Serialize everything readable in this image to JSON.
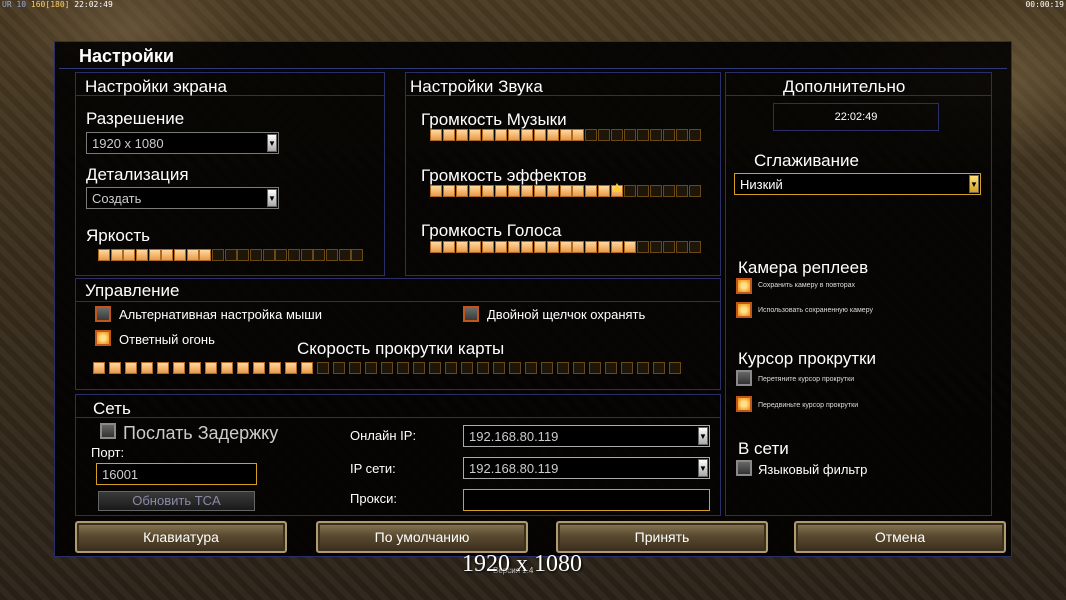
{
  "hud": {
    "left_a": "UR 10",
    "left_b": "160[180]",
    "left_time": "22:02:49",
    "right_time": "00:00:19"
  },
  "dialog": {
    "title": "Настройки"
  },
  "screen": {
    "title": "Настройки экрана",
    "resolution_label": "Разрешение",
    "resolution_value": "1920 x 1080",
    "detail_label": "Детализация",
    "detail_value": "Создать",
    "brightness_label": "Яркость",
    "brightness_level": 9,
    "brightness_total": 21
  },
  "sound": {
    "title": "Настройки Звука",
    "music_label": "Громкость Музыки",
    "music_level": 12,
    "effects_label": "Громкость эффектов",
    "effects_level": 15,
    "voice_label": "Громкость Голоса",
    "voice_level": 16,
    "total": 21
  },
  "extra": {
    "title": "Дополнительно",
    "clock": "22:02:49",
    "aa_label": "Сглаживание",
    "aa_value": "Низкий",
    "replay_title": "Камера реплеев",
    "replay_save": "Сохранить камеру в повторах",
    "replay_use": "Использовать сохраненную камеру",
    "cursor_title": "Курсор прокрутки",
    "cursor_drag": "Перетяните курсор прокрутки",
    "cursor_move": "Передвиньте курсор прокрутки",
    "online_title": "В сети",
    "lang_filter": "Языковый фильтр"
  },
  "control": {
    "title": "Управление",
    "alt_mouse": "Альтернативная настройка мыши",
    "double_click": "Двойной щелчок охранять",
    "return_fire": "Ответный огонь",
    "scroll_label": "Скорость прокрутки карты",
    "scroll_level": 14,
    "scroll_total": 37
  },
  "network": {
    "title": "Сеть",
    "send_delay": "Послать Задержку",
    "port_label": "Порт:",
    "port_value": "16001",
    "update_btn": "Обновить TCA",
    "online_ip_label": "Онлайн IP:",
    "online_ip_value": "192.168.80.119",
    "lan_ip_label": "IP сети:",
    "lan_ip_value": "192.168.80.119",
    "proxy_label": "Прокси:",
    "proxy_value": ""
  },
  "buttons": {
    "keyboard": "Клавиатура",
    "defaults": "По умолчанию",
    "accept": "Принять",
    "cancel": "Отмена"
  },
  "overlay": {
    "resolution": "1920 x 1080",
    "version": "Версия 1.4"
  }
}
